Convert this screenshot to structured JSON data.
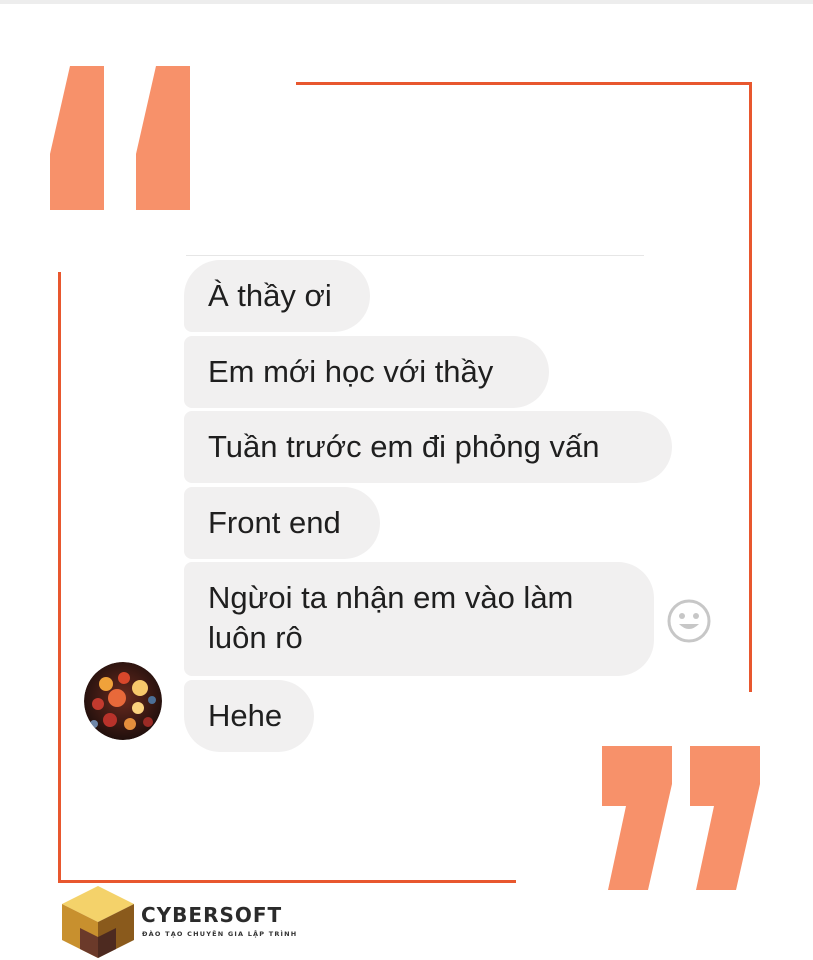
{
  "colors": {
    "frame_line": "#e8572e",
    "quote_mark": "#f7916a",
    "bubble_bg": "#f1f0f0",
    "bubble_text": "#1f1f1f"
  },
  "chat": {
    "messages": [
      {
        "text": "À thầy ơi"
      },
      {
        "text": "Em mới học với thầy"
      },
      {
        "text": "Tuần trước em đi phỏng vấn"
      },
      {
        "text": "Front end"
      },
      {
        "text": "Ngừoi ta nhận em vào làm luôn rô"
      },
      {
        "text": "Hehe"
      }
    ],
    "reaction_icon": "smiley-emoji-icon",
    "avatar_icon": "lanterns-avatar-image"
  },
  "decor": {
    "open_quote_icon": "open-quote-icon",
    "close_quote_icon": "close-quote-icon"
  },
  "brand": {
    "name": "CYBERSOFT",
    "tagline": "ĐÀO TẠO CHUYÊN GIA LẬP TRÌNH",
    "logo_icon": "cube-logo-icon"
  }
}
